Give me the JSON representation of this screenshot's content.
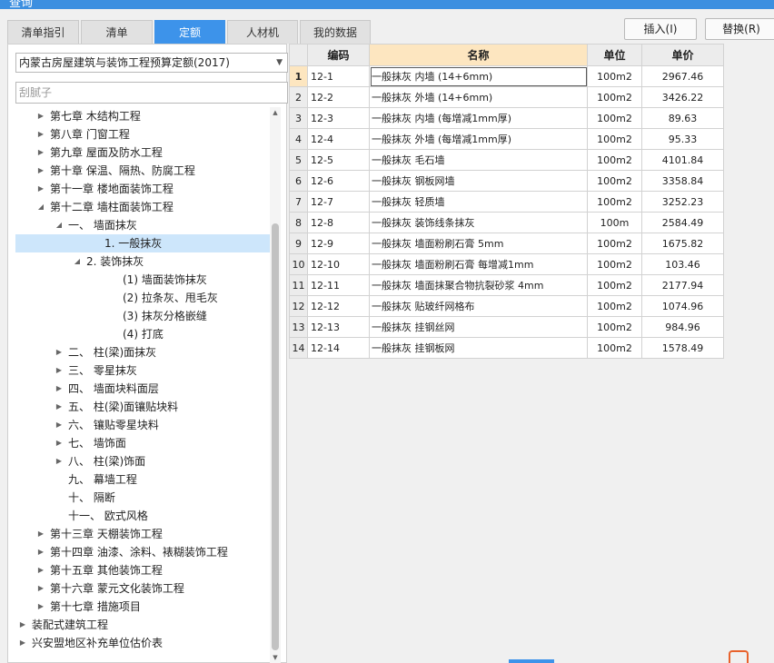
{
  "window": {
    "title": "查询"
  },
  "tabs": [
    {
      "label": "清单指引"
    },
    {
      "label": "清单"
    },
    {
      "label": "定额"
    },
    {
      "label": "人材机"
    },
    {
      "label": "我的数据"
    }
  ],
  "toolbar": {
    "insert_label": "插入(I)",
    "replace_label": "替换(R)"
  },
  "left": {
    "quota_select": "内蒙古房屋建筑与装饰工程预算定额(2017)",
    "search_placeholder": "刮腻子",
    "tree": [
      {
        "label": "第七章 木结构工程",
        "toggle": "▶"
      },
      {
        "label": "第八章 门窗工程",
        "toggle": "▶"
      },
      {
        "label": "第九章 屋面及防水工程",
        "toggle": "▶"
      },
      {
        "label": "第十章 保温、隔热、防腐工程",
        "toggle": "▶"
      },
      {
        "label": "第十一章 楼地面装饰工程",
        "toggle": "▶"
      },
      {
        "label": "第十二章 墙柱面装饰工程",
        "toggle": "◢"
      },
      {
        "label": "一、 墙面抹灰",
        "toggle": "◢"
      },
      {
        "label": "1. 一般抹灰",
        "toggle": ""
      },
      {
        "label": "2. 装饰抹灰",
        "toggle": "◢"
      },
      {
        "label": "(1) 墙面装饰抹灰",
        "toggle": ""
      },
      {
        "label": "(2) 拉条灰、甩毛灰",
        "toggle": ""
      },
      {
        "label": "(3) 抹灰分格嵌缝",
        "toggle": ""
      },
      {
        "label": "(4) 打底",
        "toggle": ""
      },
      {
        "label": "二、 柱(梁)面抹灰",
        "toggle": "▶"
      },
      {
        "label": "三、 零星抹灰",
        "toggle": "▶"
      },
      {
        "label": "四、 墙面块料面层",
        "toggle": "▶"
      },
      {
        "label": "五、 柱(梁)面镶贴块料",
        "toggle": "▶"
      },
      {
        "label": "六、 镶贴零星块料",
        "toggle": "▶"
      },
      {
        "label": "七、 墙饰面",
        "toggle": "▶"
      },
      {
        "label": "八、 柱(梁)饰面",
        "toggle": "▶"
      },
      {
        "label": "九、 幕墙工程",
        "toggle": ""
      },
      {
        "label": "十、 隔断",
        "toggle": ""
      },
      {
        "label": "十一、 欧式风格",
        "toggle": ""
      },
      {
        "label": "第十三章 天棚装饰工程",
        "toggle": "▶"
      },
      {
        "label": "第十四章 油漆、涂料、裱糊装饰工程",
        "toggle": "▶"
      },
      {
        "label": "第十五章 其他装饰工程",
        "toggle": "▶"
      },
      {
        "label": "第十六章 蒙元文化装饰工程",
        "toggle": "▶"
      },
      {
        "label": "第十七章 措施项目",
        "toggle": "▶"
      },
      {
        "label": "装配式建筑工程",
        "toggle": "▶"
      },
      {
        "label": "兴安盟地区补充单位估价表",
        "toggle": "▶"
      }
    ]
  },
  "grid": {
    "headers": {
      "code": "编码",
      "name": "名称",
      "unit": "单位",
      "price": "单价"
    },
    "rows": [
      {
        "idx": "1",
        "code": "12-1",
        "name": "一般抹灰 内墙 (14+6mm)",
        "unit": "100m2",
        "price": "2967.46"
      },
      {
        "idx": "2",
        "code": "12-2",
        "name": "一般抹灰 外墙 (14+6mm)",
        "unit": "100m2",
        "price": "3426.22"
      },
      {
        "idx": "3",
        "code": "12-3",
        "name": "一般抹灰 内墙 (每增减1mm厚)",
        "unit": "100m2",
        "price": "89.63"
      },
      {
        "idx": "4",
        "code": "12-4",
        "name": "一般抹灰 外墙 (每增减1mm厚)",
        "unit": "100m2",
        "price": "95.33"
      },
      {
        "idx": "5",
        "code": "12-5",
        "name": "一般抹灰 毛石墙",
        "unit": "100m2",
        "price": "4101.84"
      },
      {
        "idx": "6",
        "code": "12-6",
        "name": "一般抹灰 钢板网墙",
        "unit": "100m2",
        "price": "3358.84"
      },
      {
        "idx": "7",
        "code": "12-7",
        "name": "一般抹灰 轻质墙",
        "unit": "100m2",
        "price": "3252.23"
      },
      {
        "idx": "8",
        "code": "12-8",
        "name": "一般抹灰 装饰线条抹灰",
        "unit": "100m",
        "price": "2584.49"
      },
      {
        "idx": "9",
        "code": "12-9",
        "name": "一般抹灰 墙面粉刷石膏 5mm",
        "unit": "100m2",
        "price": "1675.82"
      },
      {
        "idx": "10",
        "code": "12-10",
        "name": "一般抹灰 墙面粉刷石膏 每增减1mm",
        "unit": "100m2",
        "price": "103.46"
      },
      {
        "idx": "11",
        "code": "12-11",
        "name": "一般抹灰 墙面抹聚合物抗裂砂浆 4mm",
        "unit": "100m2",
        "price": "2177.94"
      },
      {
        "idx": "12",
        "code": "12-12",
        "name": "一般抹灰 贴玻纤网格布",
        "unit": "100m2",
        "price": "1074.96"
      },
      {
        "idx": "13",
        "code": "12-13",
        "name": "一般抹灰 挂钢丝网",
        "unit": "100m2",
        "price": "984.96"
      },
      {
        "idx": "14",
        "code": "12-14",
        "name": "一般抹灰 挂钢板网",
        "unit": "100m2",
        "price": "1578.49"
      }
    ]
  },
  "colors": {
    "accent": "#3d93ea",
    "selection": "#cde6fb",
    "header_highlight": "#fde6c0"
  }
}
